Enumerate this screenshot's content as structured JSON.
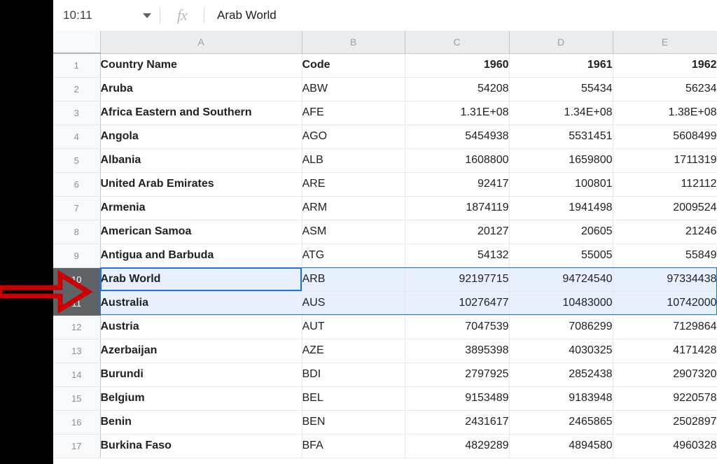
{
  "app": {
    "type": "spreadsheet"
  },
  "formula_bar": {
    "name_box_value": "10:11",
    "name_box_dropdown_icon": "chevron-down-icon",
    "fx_label": "fx",
    "formula_value": "Arab World"
  },
  "grid": {
    "column_headers": [
      "A",
      "B",
      "C",
      "D",
      "E"
    ],
    "row_numbers": [
      "1",
      "2",
      "3",
      "4",
      "5",
      "6",
      "7",
      "8",
      "9",
      "10",
      "11",
      "12",
      "13",
      "14",
      "15",
      "16",
      "17"
    ],
    "selected_rows": [
      "10",
      "11"
    ],
    "active_cell": "A10",
    "selection_color": "#1a73e8",
    "selection_fill": "#e8f0fe",
    "selected_header_bg": "#5f6368",
    "rows": [
      {
        "n": "1",
        "a": "Country Name",
        "b": "Code",
        "c": "1960",
        "d": "1961",
        "e": "1962",
        "header": true,
        "selected": false
      },
      {
        "n": "2",
        "a": "Aruba",
        "b": "ABW",
        "c": "54208",
        "d": "55434",
        "e": "56234",
        "header": false,
        "selected": false
      },
      {
        "n": "3",
        "a": "Africa Eastern and Southern",
        "b": "AFE",
        "c": "1.31E+08",
        "d": "1.34E+08",
        "e": "1.38E+08",
        "header": false,
        "selected": false
      },
      {
        "n": "4",
        "a": "Angola",
        "b": "AGO",
        "c": "5454938",
        "d": "5531451",
        "e": "5608499",
        "header": false,
        "selected": false
      },
      {
        "n": "5",
        "a": "Albania",
        "b": "ALB",
        "c": "1608800",
        "d": "1659800",
        "e": "1711319",
        "header": false,
        "selected": false
      },
      {
        "n": "6",
        "a": "United Arab Emirates",
        "b": "ARE",
        "c": "92417",
        "d": "100801",
        "e": "112112",
        "header": false,
        "selected": false
      },
      {
        "n": "7",
        "a": "Armenia",
        "b": "ARM",
        "c": "1874119",
        "d": "1941498",
        "e": "2009524",
        "header": false,
        "selected": false
      },
      {
        "n": "8",
        "a": "American Samoa",
        "b": "ASM",
        "c": "20127",
        "d": "20605",
        "e": "21246",
        "header": false,
        "selected": false
      },
      {
        "n": "9",
        "a": "Antigua and Barbuda",
        "b": "ATG",
        "c": "54132",
        "d": "55005",
        "e": "55849",
        "header": false,
        "selected": false
      },
      {
        "n": "10",
        "a": "Arab World",
        "b": "ARB",
        "c": "92197715",
        "d": "94724540",
        "e": "97334438",
        "header": false,
        "selected": true
      },
      {
        "n": "11",
        "a": "Australia",
        "b": "AUS",
        "c": "10276477",
        "d": "10483000",
        "e": "10742000",
        "header": false,
        "selected": true
      },
      {
        "n": "12",
        "a": "Austria",
        "b": "AUT",
        "c": "7047539",
        "d": "7086299",
        "e": "7129864",
        "header": false,
        "selected": false
      },
      {
        "n": "13",
        "a": "Azerbaijan",
        "b": "AZE",
        "c": "3895398",
        "d": "4030325",
        "e": "4171428",
        "header": false,
        "selected": false
      },
      {
        "n": "14",
        "a": "Burundi",
        "b": "BDI",
        "c": "2797925",
        "d": "2852438",
        "e": "2907320",
        "header": false,
        "selected": false
      },
      {
        "n": "15",
        "a": "Belgium",
        "b": "BEL",
        "c": "9153489",
        "d": "9183948",
        "e": "9220578",
        "header": false,
        "selected": false
      },
      {
        "n": "16",
        "a": "Benin",
        "b": "BEN",
        "c": "2431617",
        "d": "2465865",
        "e": "2502897",
        "header": false,
        "selected": false
      },
      {
        "n": "17",
        "a": "Burkina Faso",
        "b": "BFA",
        "c": "4829289",
        "d": "4894580",
        "e": "4960328",
        "header": false,
        "selected": false
      }
    ]
  },
  "annotation": {
    "arrow_icon": "right-arrow-annotation",
    "arrow_color": "#cc0000",
    "points_at_row": "10"
  }
}
